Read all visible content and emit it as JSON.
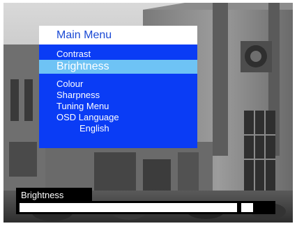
{
  "menu": {
    "title": "Main Menu",
    "items": [
      {
        "label": "Contrast"
      },
      {
        "label": "Brightness",
        "selected": true
      },
      {
        "label": "Colour"
      },
      {
        "label": "Sharpness"
      },
      {
        "label": "Tuning Menu"
      },
      {
        "label": "OSD Language"
      }
    ],
    "language_value": "English"
  },
  "slider": {
    "label": "Brightness",
    "level": 0.92
  },
  "colors": {
    "menu_background": "#0a3cf5",
    "selected_highlight": "#6ec3f5",
    "title_bar": "#ffffff",
    "title_text": "#1a49d4",
    "slider_background": "#000000",
    "slider_fill": "#ffffff"
  }
}
